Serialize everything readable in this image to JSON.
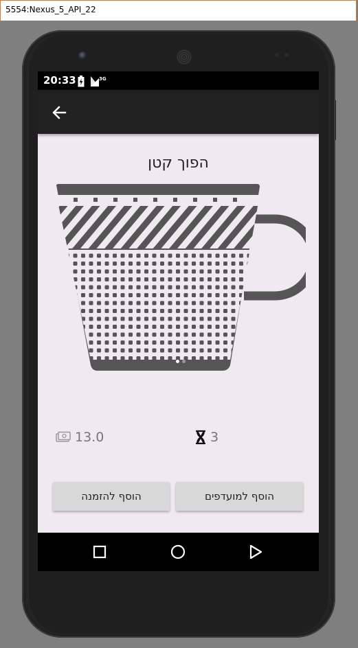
{
  "window": {
    "title": "5554:Nexus_5_API_22"
  },
  "status_bar": {
    "time": "20:33",
    "network": "3G"
  },
  "product": {
    "name": "הפוך קטן",
    "price": "13.0",
    "prep_time": "3"
  },
  "carousel": {
    "page_count": 2,
    "active_index": 0
  },
  "actions": {
    "add_to_order": "הוסף להזמנה",
    "add_to_favorites": "הוסף למועדפים"
  },
  "icons": {
    "back": "arrow-back-icon",
    "battery": "battery-charging-icon",
    "signal": "cell-signal-icon",
    "cup": "coffee-cup-illustration",
    "price": "money-icon",
    "time": "hourglass-icon",
    "nav_recents": "square-icon",
    "nav_home": "circle-icon",
    "nav_back": "triangle-back-icon"
  },
  "colors": {
    "screen_bg": "#efeaef",
    "app_bar": "#212121",
    "button_bg": "#d8d8d8",
    "cup": "#555555"
  }
}
